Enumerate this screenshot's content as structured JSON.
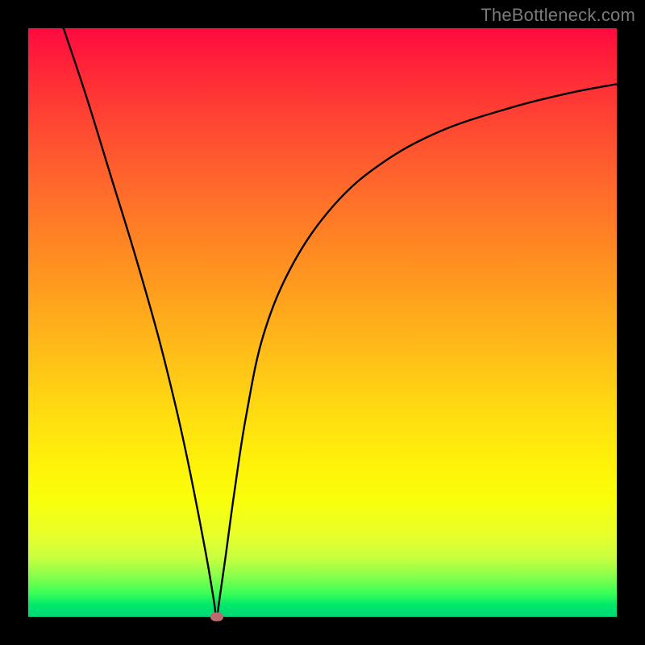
{
  "watermark": "TheBottleneck.com",
  "chart_data": {
    "type": "line",
    "title": "",
    "xlabel": "",
    "ylabel": "",
    "xlim": [
      0,
      100
    ],
    "ylim": [
      0,
      100
    ],
    "gradient_stops": [
      {
        "pos": 0,
        "color": "#ff0a3e"
      },
      {
        "pos": 8,
        "color": "#ff2a37"
      },
      {
        "pos": 22,
        "color": "#ff5a2f"
      },
      {
        "pos": 38,
        "color": "#ff8a22"
      },
      {
        "pos": 52,
        "color": "#ffb41a"
      },
      {
        "pos": 64,
        "color": "#ffd812"
      },
      {
        "pos": 74,
        "color": "#fff20a"
      },
      {
        "pos": 80,
        "color": "#f9ff0a"
      },
      {
        "pos": 86,
        "color": "#e8ff2a"
      },
      {
        "pos": 90,
        "color": "#c8ff40"
      },
      {
        "pos": 93,
        "color": "#8aff4a"
      },
      {
        "pos": 96,
        "color": "#3aff58"
      },
      {
        "pos": 98,
        "color": "#00e86b"
      },
      {
        "pos": 100,
        "color": "#00d878"
      }
    ],
    "series": [
      {
        "name": "curve",
        "x": [
          6,
          10,
          14,
          18,
          22,
          25,
          27,
          29,
          30.5,
          31.5,
          32,
          32.5,
          33.5,
          35,
          37,
          40,
          45,
          52,
          60,
          70,
          82,
          92,
          100
        ],
        "values": [
          100,
          88,
          75,
          62,
          48,
          36,
          27,
          17,
          9,
          3,
          0,
          3,
          10,
          21,
          34,
          48,
          60,
          70,
          77,
          82.5,
          86.5,
          89,
          90.5
        ]
      }
    ],
    "marker": {
      "x": 32,
      "y": 0,
      "color": "#bc6a6d"
    }
  }
}
